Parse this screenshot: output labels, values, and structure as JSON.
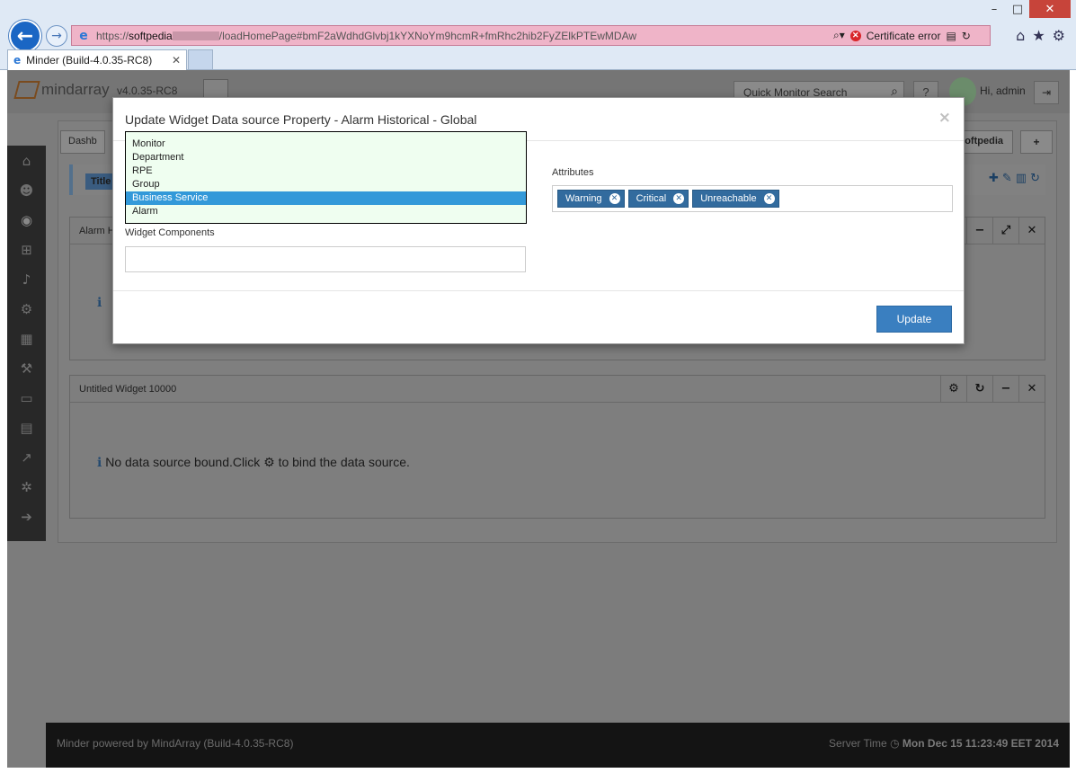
{
  "browser": {
    "window_controls": [
      "–",
      "□",
      "✕"
    ],
    "url_prefix": "https://",
    "url_host": "softpedia",
    "url_path": "/loadHomePage#bmF2aWdhdGlvbj1kYXNoYm9hcmR+fmRhc2hib2FyZElkPTEwMDAw",
    "cert_error": "Certificate error",
    "tab_title": "Minder (Build-4.0.35-RC8)"
  },
  "app": {
    "logo_text": "mindarray",
    "version": "v4.0.35-RC8",
    "quick_search_placeholder": "Quick Monitor Search",
    "help_label": "?",
    "greeting": "Hi, admin",
    "dashboard_tab": "Dashb",
    "softpedia_tab": "Softpedia",
    "add_tab": "+",
    "title_label": "Title",
    "widget1_title": "Alarm H",
    "widget2_title": "Untitled Widget 10000",
    "no_data_msg_a": "No data source bound.Click",
    "no_data_msg_b": "to bind the data source.",
    "footer_left": "Minder powered by MindArray (Build-4.0.35-RC8)",
    "footer_server_label": "Server Time",
    "footer_server_time": "Mon Dec 15 11:23:49 EET 2014"
  },
  "modal": {
    "title": "Update Widget Data source Property - Alarm Historical - Global",
    "close": "×",
    "options": [
      "Monitor",
      "Department",
      "RPE",
      "Group",
      "Business Service",
      "Alarm"
    ],
    "selected_option": "Business Service",
    "widget_components_label": "Widget Components",
    "widget_components_value": "",
    "attributes_label": "Attributes",
    "attributes": [
      "Warning",
      "Critical",
      "Unreachable"
    ],
    "update_button": "Update"
  },
  "colors": {
    "accent": "#3a7fc0",
    "chip": "#326b9e",
    "selection": "#3399d9",
    "listbox_bg": "#effef0",
    "address_bar_error": "#efb4c8"
  },
  "icons": {
    "sidebar": [
      "home-icon",
      "users-icon",
      "dashboard-icon",
      "topology-icon",
      "bell-icon",
      "gear-icon",
      "calculator-icon",
      "wrench-icon",
      "monitor-icon",
      "calendar-icon",
      "chart-icon",
      "cogs-icon",
      "arrow-right-icon"
    ]
  }
}
